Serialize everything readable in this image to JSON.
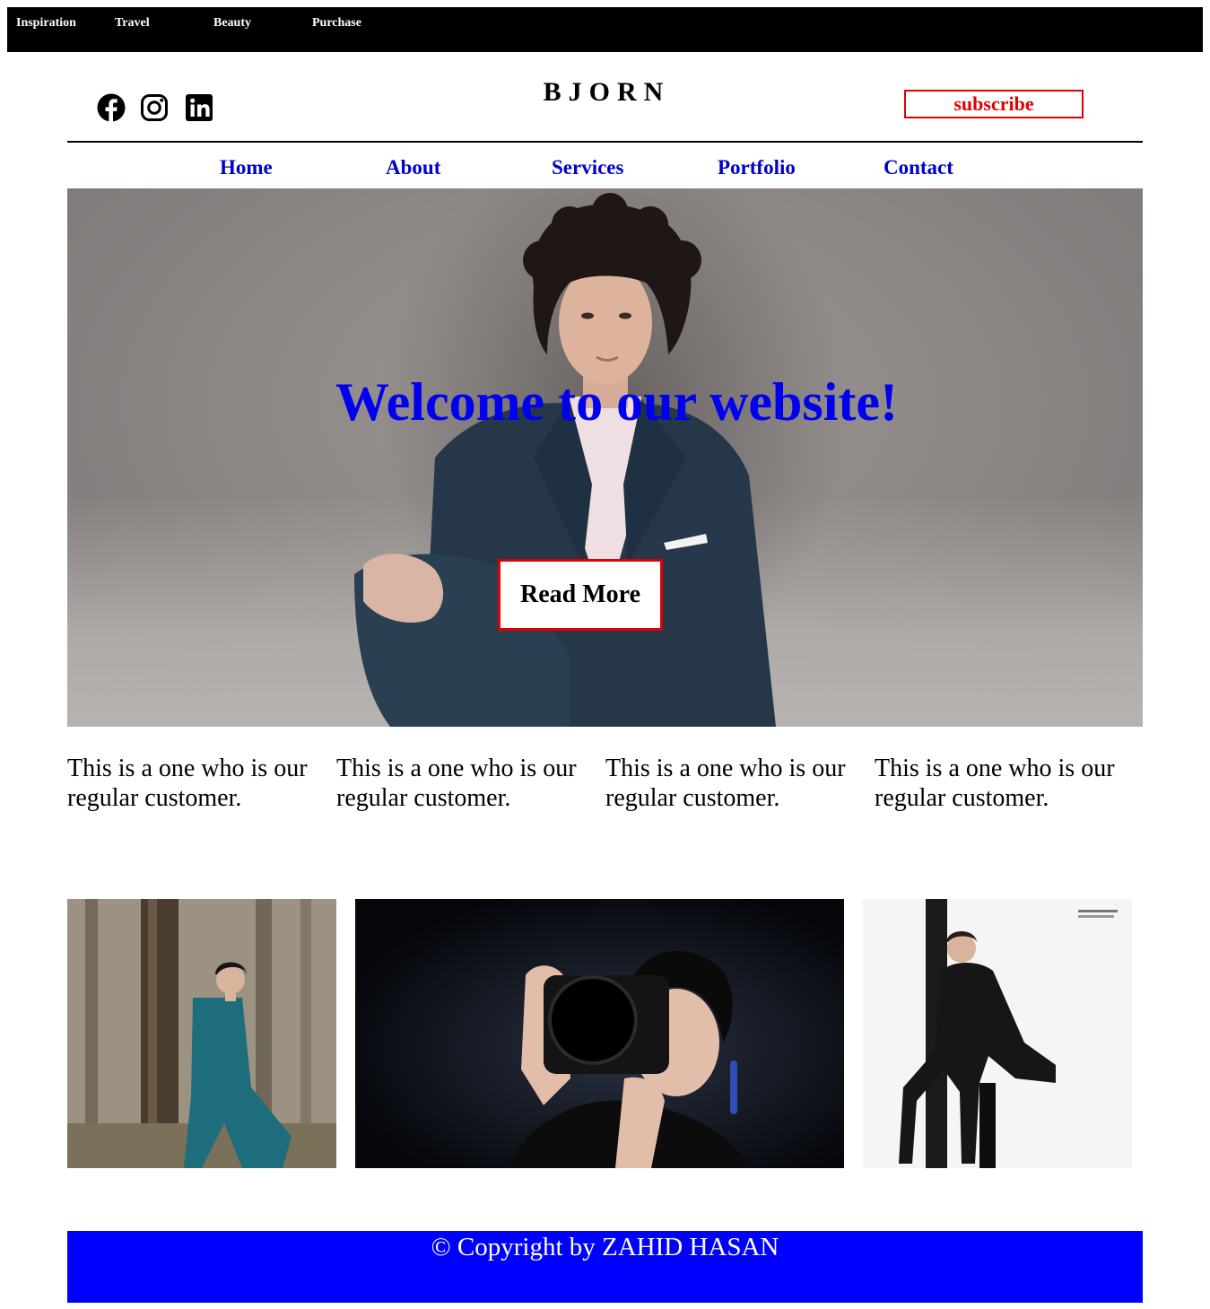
{
  "topbar": {
    "links": [
      "Inspiration",
      "Travel",
      "Beauty",
      "Purchase"
    ]
  },
  "header": {
    "brand": "BJORN",
    "subscribe_label": "subscribe",
    "social_icons": [
      "facebook-icon",
      "instagram-icon",
      "linkedin-icon"
    ]
  },
  "nav": {
    "items": [
      "Home",
      "About",
      "Services",
      "Portfolio",
      "Contact"
    ]
  },
  "hero": {
    "heading": "Welcome to our website!",
    "button_label": "Read More"
  },
  "testimonials": [
    "This is a one who is our regular customer.",
    "This is a one who is our regular customer.",
    "This is a one who is our regular customer.",
    "This is a one who is our regular customer."
  ],
  "footer": {
    "copyright": "© Copyright by ZAHID HASAN"
  },
  "colors": {
    "nav_link": "#0000cc",
    "hero_heading": "#0000ee",
    "subscribe": "#e00000",
    "footer_bg": "#0000ff"
  }
}
